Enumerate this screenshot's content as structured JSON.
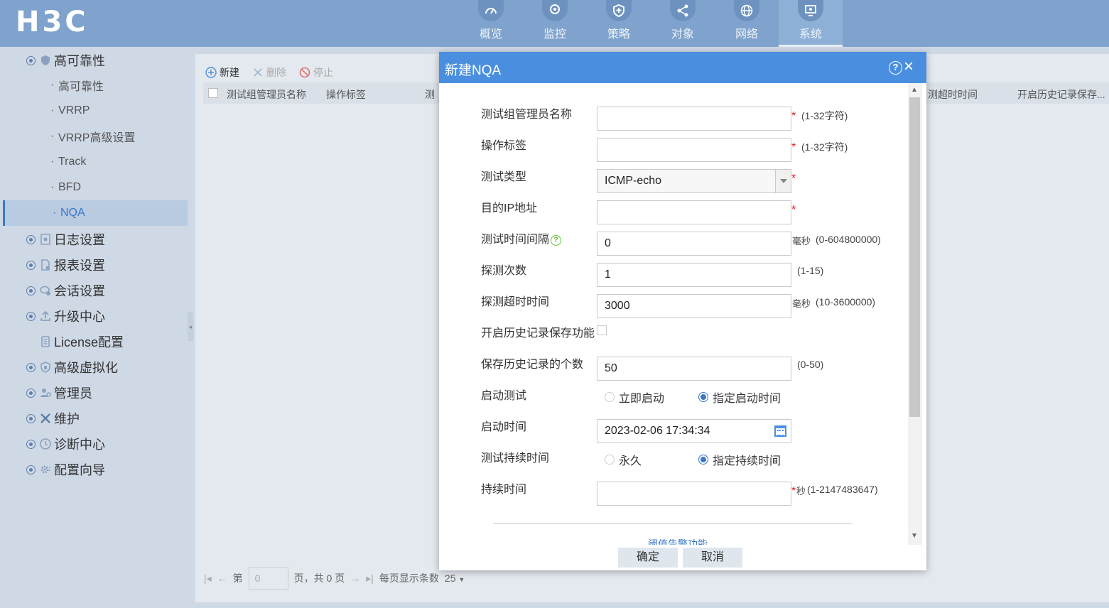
{
  "brand": "H3C",
  "nav": [
    {
      "label": "概览",
      "icon": "dashboard-icon"
    },
    {
      "label": "监控",
      "icon": "monitor-icon"
    },
    {
      "label": "策略",
      "icon": "shield-icon"
    },
    {
      "label": "对象",
      "icon": "share-icon"
    },
    {
      "label": "网络",
      "icon": "globe-icon"
    },
    {
      "label": "系统",
      "icon": "system-icon",
      "active": true
    }
  ],
  "sidebar": {
    "group_ha": "高可靠性",
    "sub": [
      "高可靠性",
      "VRRP",
      "VRRP高级设置",
      "Track",
      "BFD",
      "NQA"
    ],
    "active_sub": "NQA",
    "groups": [
      "日志设置",
      "报表设置",
      "会话设置",
      "升级中心",
      "License配置",
      "高级虚拟化",
      "管理员",
      "维护",
      "诊断中心",
      "配置向导"
    ],
    "sub_dot": "·"
  },
  "toolbar": {
    "new": "新建",
    "delete": "删除",
    "stop": "停止"
  },
  "grid": {
    "columns": [
      "测试组管理员名称",
      "操作标签",
      "测",
      "测超时时间",
      "开启历史记录保存..."
    ]
  },
  "pager": {
    "page_prefix": "第",
    "page_value": "0",
    "page_suffix": "页，共 0 页",
    "per_page_label": "每页显示条数",
    "per_page_value": "25"
  },
  "dialog": {
    "title": "新建NQA",
    "help": "?",
    "close": "×",
    "fields": {
      "admin_name": {
        "label": "测试组管理员名称",
        "value": "",
        "hint": "(1-32字符)"
      },
      "op_tag": {
        "label": "操作标签",
        "value": "",
        "hint": "(1-32字符)"
      },
      "test_type": {
        "label": "测试类型",
        "value": "ICMP-echo"
      },
      "dest_ip": {
        "label": "目的IP地址",
        "value": ""
      },
      "interval": {
        "label": "测试时间间隔",
        "value": "0",
        "unit": "毫秒",
        "hint": "(0-604800000)"
      },
      "probe_count": {
        "label": "探测次数",
        "value": "1",
        "hint": "(1-15)"
      },
      "probe_timeout": {
        "label": "探测超时时间",
        "value": "3000",
        "unit": "毫秒",
        "hint": "(10-3600000)"
      },
      "history_enable": {
        "label": "开启历史记录保存功能",
        "checked": false
      },
      "history_count": {
        "label": "保存历史记录的个数",
        "value": "50",
        "hint": "(0-50)"
      },
      "start_test": {
        "label": "启动测试",
        "option_now": "立即启动",
        "option_scheduled": "指定启动时间",
        "selected": "指定启动时间"
      },
      "start_time": {
        "label": "启动时间",
        "value": "2023-02-06 17:34:34"
      },
      "duration_mode": {
        "label": "测试持续时间",
        "option_forever": "永久",
        "option_specified": "指定持续时间",
        "selected": "指定持续时间"
      },
      "duration": {
        "label": "持续时间",
        "value": "",
        "unit": "秒",
        "hint": "(1-2147483647)"
      }
    },
    "required_mark": "*",
    "section_link": "阈值告警功能",
    "ok": "确定",
    "cancel": "取消"
  },
  "colors": {
    "header_bg": "#7fa3cc",
    "dialog_header": "#4a8fdf",
    "accent": "#3a78c8",
    "required": "#e02020",
    "help_green": "#6abf3a"
  }
}
